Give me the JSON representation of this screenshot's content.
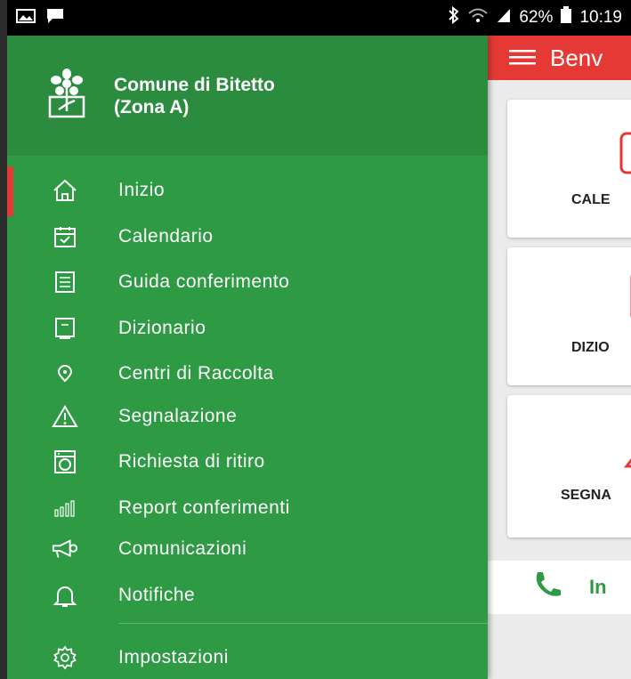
{
  "status_bar": {
    "battery": "62%",
    "time": "10:19",
    "icons": [
      "image-icon",
      "message-icon",
      "bluetooth-icon",
      "wifi-icon",
      "signal-icon",
      "battery-icon"
    ]
  },
  "background_app": {
    "header_title": "Benv",
    "cards": [
      {
        "label": "CALE",
        "icon": "calendar-icon"
      },
      {
        "label": "DIZIO",
        "icon": "dictionary-icon"
      },
      {
        "label": "SEGNA",
        "icon": "warning-icon"
      }
    ],
    "call_label": "In",
    "colors": {
      "header": "#e53935",
      "accent_green": "#2e9a44"
    }
  },
  "drawer": {
    "title_line1": "Comune di Bitetto",
    "title_line2": "(Zona A)",
    "logo": "flower-logo-icon",
    "items": [
      {
        "label": "Inizio",
        "icon": "home-icon",
        "active": true
      },
      {
        "label": "Calendario",
        "icon": "calendar-icon"
      },
      {
        "label": "Guida conferimento",
        "icon": "list-icon"
      },
      {
        "label": "Dizionario",
        "icon": "dictionary-icon"
      },
      {
        "label": "Centri di Raccolta",
        "icon": "location-pin-icon"
      },
      {
        "label": "Segnalazione",
        "icon": "warning-icon"
      },
      {
        "label": "Richiesta di ritiro",
        "icon": "washing-machine-icon"
      },
      {
        "label": "Report conferimenti",
        "icon": "bar-chart-icon"
      },
      {
        "label": "Comunicazioni",
        "icon": "megaphone-icon"
      },
      {
        "label": "Notifiche",
        "icon": "bell-icon"
      },
      {
        "label": "Impostazioni",
        "icon": "gear-icon"
      }
    ],
    "colors": {
      "background": "#2e9a44",
      "header": "#2b8c3f",
      "active_marker": "#e53935"
    }
  }
}
